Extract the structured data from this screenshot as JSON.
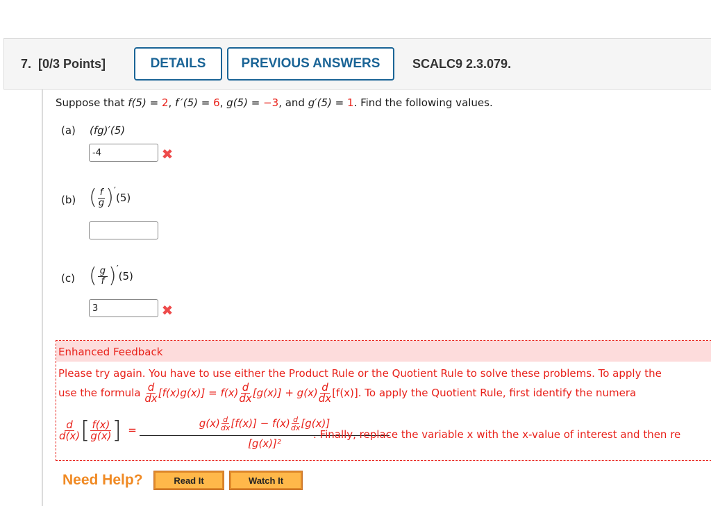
{
  "question": {
    "number_label": "7.",
    "points_label": "[0/3 Points]",
    "details_button": "DETAILS",
    "previous_answers_button": "PREVIOUS ANSWERS",
    "code": "SCALC9 2.3.079."
  },
  "intro": {
    "prefix": "Suppose that ",
    "f_expr": "f(5)",
    "f_val": "2",
    "fp_expr": "f ′(5)",
    "fp_val": "6",
    "g_expr": "g(5)",
    "g_val": "−3",
    "gp_expr": "g′(5)",
    "gp_val": "1",
    "suffix": ". Find the following values."
  },
  "parts": [
    {
      "label": "(a)",
      "expression": "(fg)′(5)",
      "answer": "-4",
      "status": "incorrect"
    },
    {
      "label": "(b)",
      "numerator": "f",
      "denominator": "g",
      "suffix": "(5)",
      "answer": "",
      "status": "unanswered"
    },
    {
      "label": "(c)",
      "numerator": "g",
      "denominator": "f",
      "suffix": "(5)",
      "answer": "3",
      "status": "incorrect"
    }
  ],
  "feedback": {
    "title": "Enhanced Feedback",
    "line1": "Please try again. You have to use either the Product Rule or the Quotient Rule to solve these problems. To apply the",
    "line2_prefix": "use the formula ",
    "line2_mid": "[f(x)g(x)] = f(x)",
    "line2_mid2": "[g(x)] + g(x)",
    "line2_mid3": "[f(x)]. To apply the Quotient Rule, first identify the numera",
    "d": "d",
    "dx": "dx",
    "dxx": "d(x)",
    "fx": "f(x)",
    "gx": "g(x)",
    "quot_top_a": "g(x)",
    "quot_top_b": "[f(x)] − f(x)",
    "quot_top_c": "[g(x)]",
    "quot_bottom": "[g(x)]²",
    "line3_suffix": ". Finally, replace the variable x with the x-value of interest and then re"
  },
  "help": {
    "label": "Need Help?",
    "read_it": "Read It",
    "watch_it": "Watch It"
  },
  "colors": {
    "accent": "#1a6496",
    "error": "#e8211a",
    "help": "#f08a24"
  }
}
